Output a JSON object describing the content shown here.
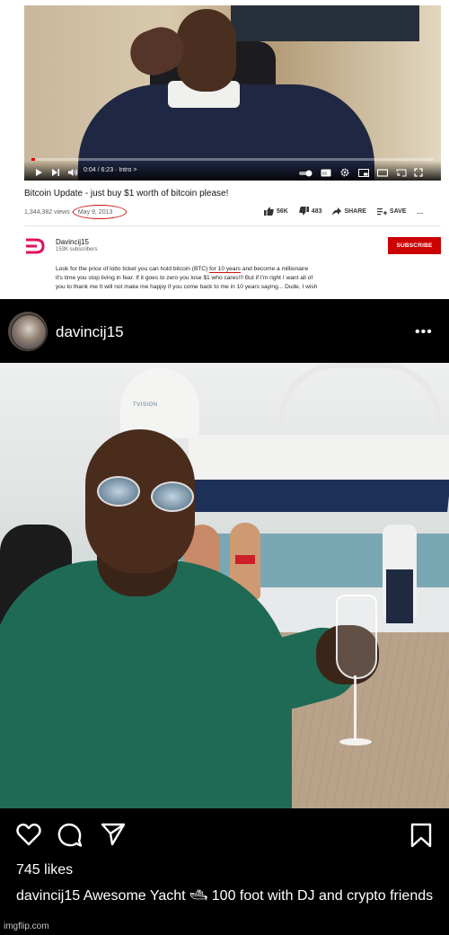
{
  "youtube": {
    "player": {
      "time": "0:04 / 6:23",
      "chapter": "Intro",
      "progress": 0.01
    },
    "title": "Bitcoin Update - just buy $1 worth of bitcoin please!",
    "views": "1,344,382 views",
    "separator": "·",
    "date": "May 9, 2013",
    "likes": "56K",
    "dislikes": "483",
    "share_label": "SHARE",
    "save_label": "SAVE",
    "more_label": "···",
    "channel": {
      "name": "Davincij15",
      "subscribers": "153K subscribers",
      "subscribe_label": "SUBSCRIBE"
    },
    "description": {
      "line1_before": "Look for the price of lotto ticket you can hold bitcoin (BTC) ",
      "line1_underlined": "for 10 years",
      "line1_after": " and become a millionaire",
      "line2": "it's time you stop living in fear.  If it goes to zero you lose $1 who cares!!!  But if I'm right I want all of",
      "line3": "you to thank me It will not make me happy if you come back to me in 10 years saying... Dude, I wish"
    },
    "colors": {
      "subscribe": "#cc0000",
      "annotation": "#d01010",
      "progress": "#ee0000"
    }
  },
  "instagram": {
    "username": "davincij15",
    "more_label": "•••",
    "likes": "745 likes",
    "caption_user": "davincij15",
    "caption_text": "Awesome Yacht 🛥 100 foot with DJ and crypto friends",
    "photo_text": "TVISION"
  },
  "watermark": "imgflip.com"
}
